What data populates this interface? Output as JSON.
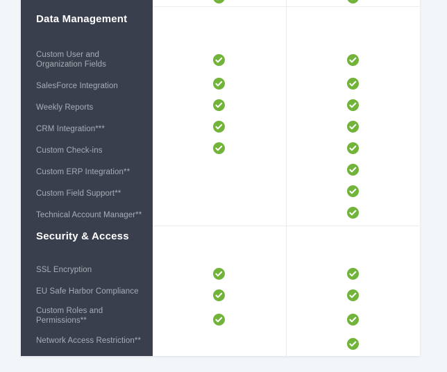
{
  "theme": {
    "page_background": "#f2f6f9",
    "card_background": "#ffffff",
    "sidebar_background": "#393f4c",
    "heading_color": "#ffffff",
    "feature_text_color": "#a9adb6",
    "check_color": "#72b43a",
    "divider_color": "#ebecee"
  },
  "table": {
    "sections": [
      {
        "id": "data-management",
        "heading": "Data Management",
        "features": [
          {
            "label": "Custom User and Organization Fields",
            "plan_a": true,
            "plan_b": true
          },
          {
            "label": "SalesForce Integration",
            "plan_a": true,
            "plan_b": true
          },
          {
            "label": "Weekly Reports",
            "plan_a": true,
            "plan_b": true
          },
          {
            "label": "CRM Integration***",
            "plan_a": true,
            "plan_b": true
          },
          {
            "label": "Custom Check-ins",
            "plan_a": true,
            "plan_b": true
          },
          {
            "label": "Custom ERP Integration**",
            "plan_a": false,
            "plan_b": true
          },
          {
            "label": "Custom Field Support**",
            "plan_a": false,
            "plan_b": true
          },
          {
            "label": "Technical Account Manager**",
            "plan_a": false,
            "plan_b": true
          }
        ]
      },
      {
        "id": "security-access",
        "heading": "Security & Access",
        "features": [
          {
            "label": "SSL Encryption",
            "plan_a": true,
            "plan_b": true
          },
          {
            "label": "EU Safe Harbor Compliance",
            "plan_a": true,
            "plan_b": true
          },
          {
            "label": "Custom Roles and Permissions**",
            "plan_a": true,
            "plan_b": true
          },
          {
            "label": "Network Access Restriction**",
            "plan_a": false,
            "plan_b": true
          }
        ]
      }
    ],
    "icons": {
      "included": "check-circle-icon"
    }
  }
}
